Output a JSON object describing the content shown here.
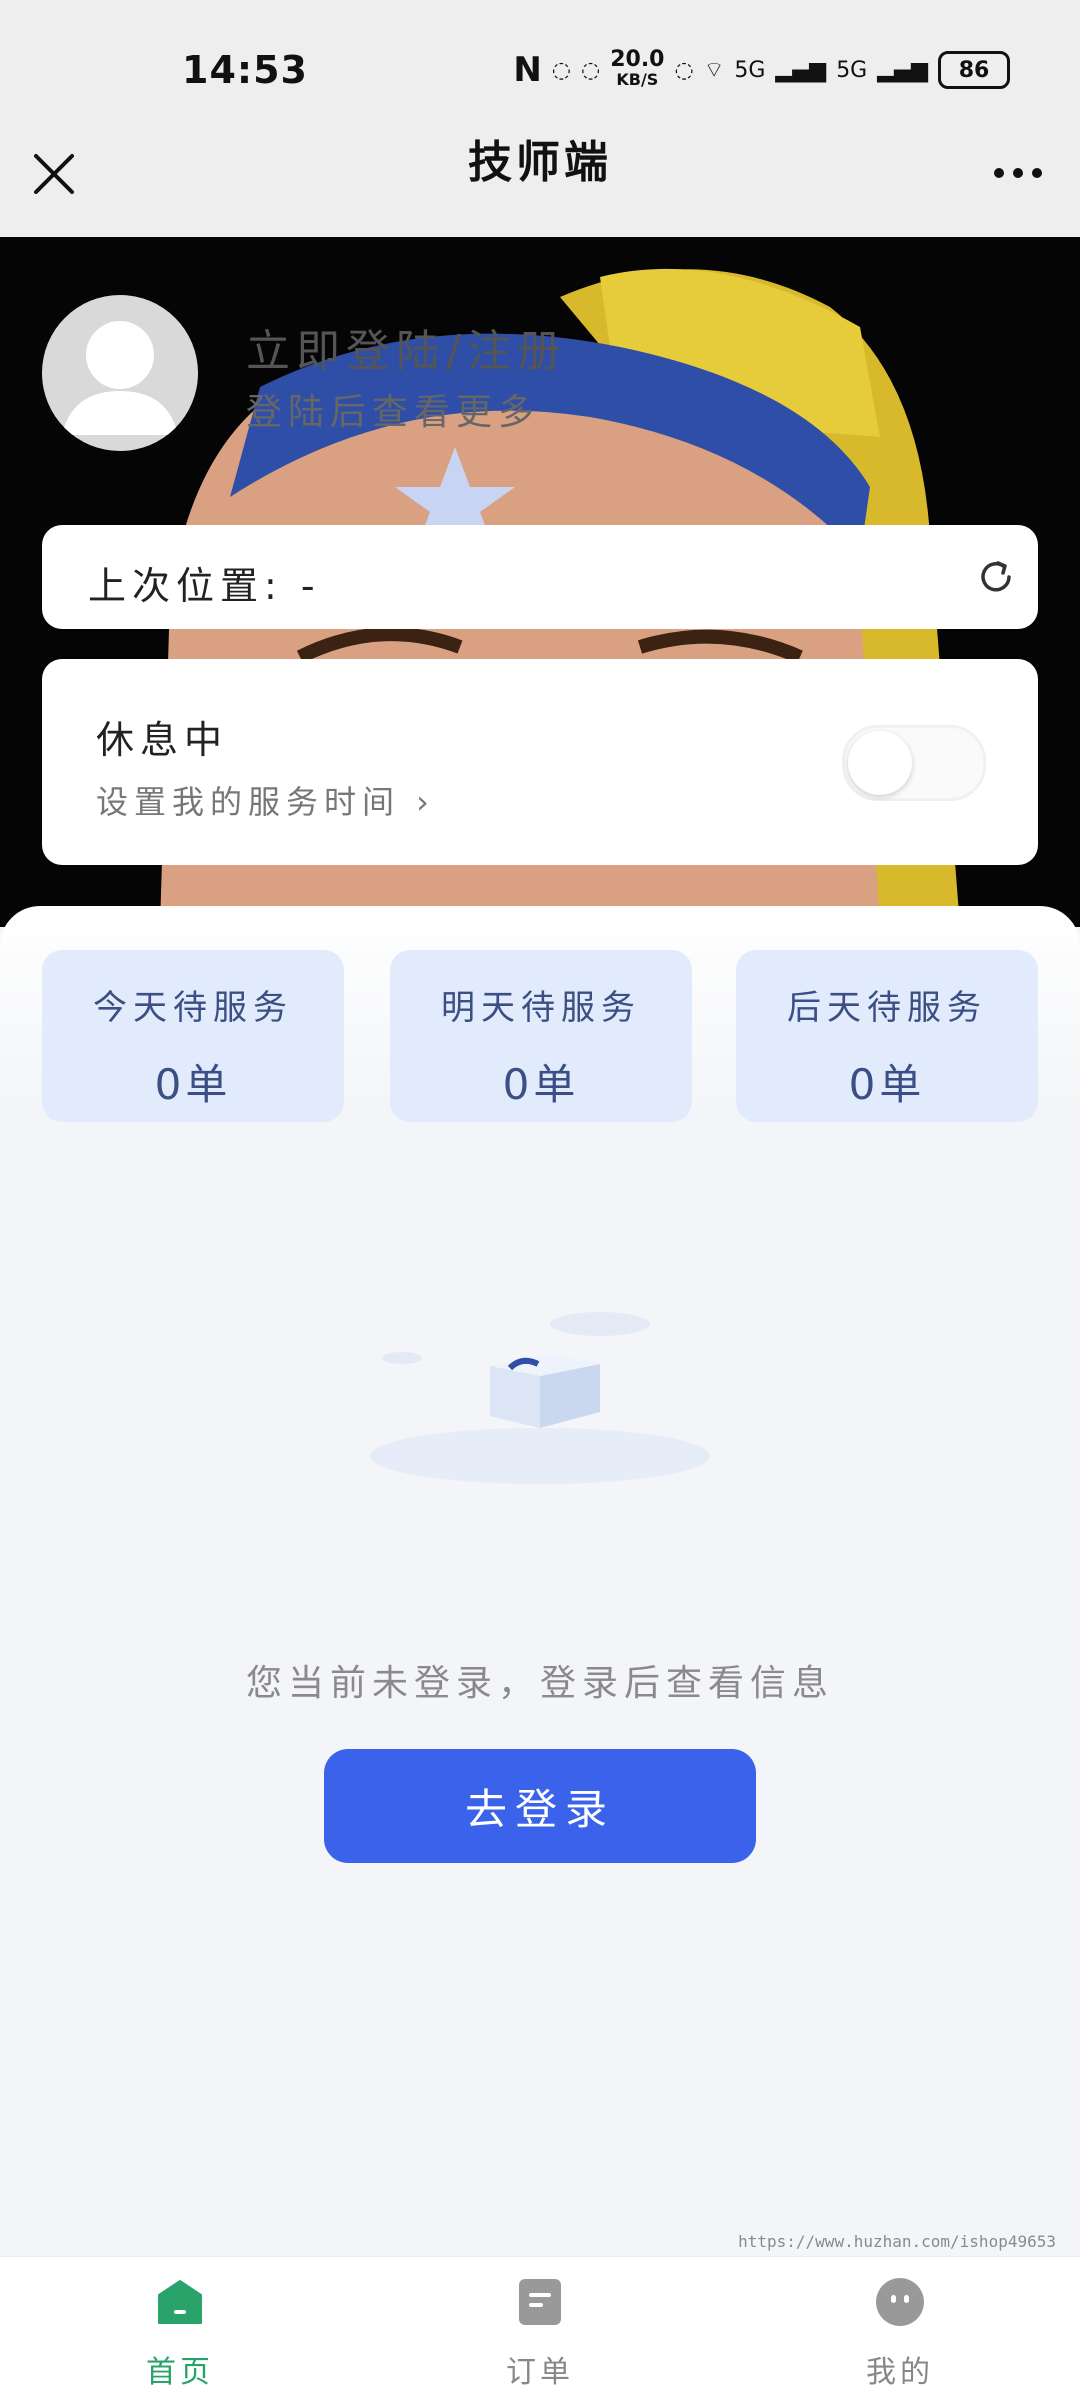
{
  "status_bar": {
    "time": "14:53",
    "nfc": "N",
    "speed_value": "20.0",
    "speed_unit": "KB/S",
    "network_1": "5G",
    "network_2": "5G",
    "battery": "86"
  },
  "nav": {
    "title": "技师端"
  },
  "profile": {
    "login_title": "立即登陆/注册",
    "login_subtitle": "登陆后查看更多"
  },
  "location": {
    "label": "上次位置: -"
  },
  "service_status": {
    "title": "休息中",
    "subtitle": "设置我的服务时间 ›",
    "toggle_on": false
  },
  "stats": [
    {
      "label": "今天待服务",
      "value": "0单"
    },
    {
      "label": "明天待服务",
      "value": "0单"
    },
    {
      "label": "后天待服务",
      "value": "0单"
    }
  ],
  "empty_state": {
    "message": "您当前未登录，登录后查看信息",
    "button": "去登录"
  },
  "watermark": "https://www.huzhan.com/ishop49653",
  "tabs": [
    {
      "label": "首页",
      "active": true,
      "color": "#2aa36b"
    },
    {
      "label": "订单",
      "active": false,
      "color": "#888888"
    },
    {
      "label": "我的",
      "active": false,
      "color": "#888888"
    }
  ],
  "colors": {
    "primary": "#3a62ea",
    "stat_card_bg": "#e2ebfb",
    "tab_active": "#2aa36b"
  }
}
